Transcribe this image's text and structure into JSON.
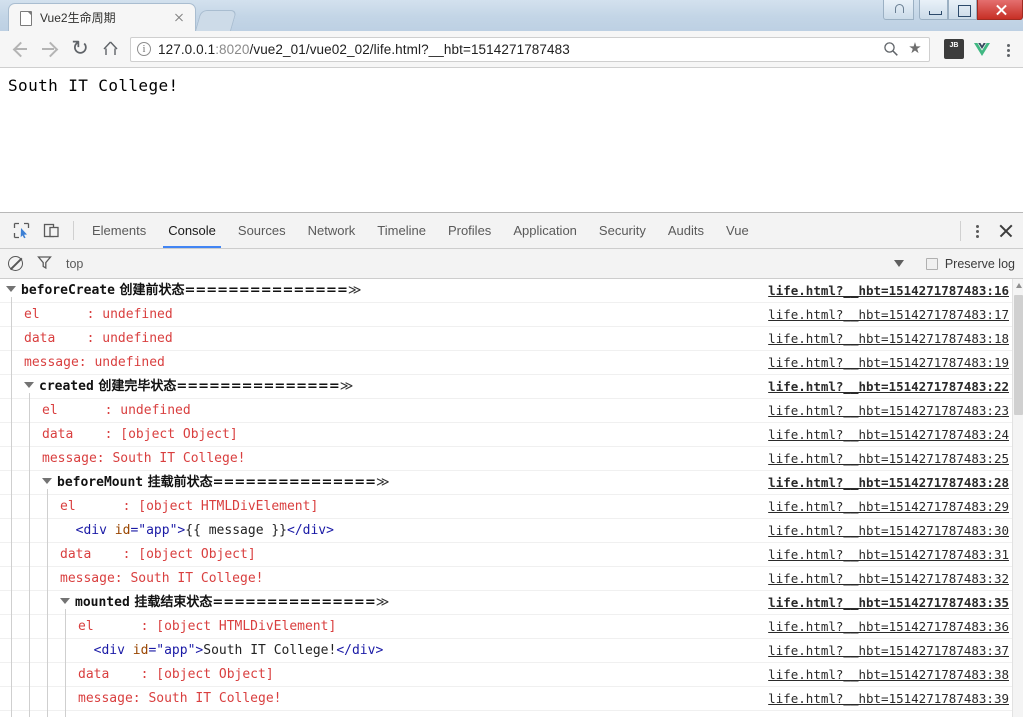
{
  "browser": {
    "tab": {
      "title": "Vue2生命周期",
      "favicon": "page-icon",
      "close": "×"
    },
    "window_controls": {
      "user": "user-icon",
      "minimize": "minimize-icon",
      "maximize": "maximize-icon",
      "close": "close-icon"
    },
    "toolbar": {
      "back": "back-arrow-icon",
      "forward": "forward-arrow-icon",
      "reload": "↻",
      "home": "home-icon",
      "info": "ⓘ",
      "url_host": "127.0.0.1",
      "url_port": ":8020",
      "url_path": "/vue2_01/vue02_02/life.html?__hbt=1514271787483",
      "url_full": "127.0.0.1:8020/vue2_01/vue02_02/life.html?__hbt=1514271787483",
      "zoom": "zoom-icon",
      "bookmark": "★",
      "ext_jetbrains": "JB",
      "ext_vue": "V",
      "menu": "chrome-menu-icon"
    }
  },
  "page": {
    "body_text": "South IT College!"
  },
  "devtools": {
    "tabs": [
      {
        "label": "Elements",
        "active": false
      },
      {
        "label": "Console",
        "active": true
      },
      {
        "label": "Sources",
        "active": false
      },
      {
        "label": "Network",
        "active": false
      },
      {
        "label": "Timeline",
        "active": false
      },
      {
        "label": "Profiles",
        "active": false
      },
      {
        "label": "Application",
        "active": false
      },
      {
        "label": "Security",
        "active": false
      },
      {
        "label": "Audits",
        "active": false
      },
      {
        "label": "Vue",
        "active": false
      }
    ],
    "inspect_icon": "inspect-element-icon",
    "device_icon": "device-toolbar-icon",
    "more_icon": "more-options-icon",
    "close_icon": "close-devtools-icon",
    "filterbar": {
      "clear_icon": "clear-console-icon",
      "filter_icon": "filter-icon",
      "context": "top",
      "context_caret": "▼",
      "preserve_log": "Preserve log",
      "preserve_checked": false
    },
    "console_rows": [
      {
        "type": "group",
        "depth": 0,
        "name": "beforeCreate",
        "cn": " 创建前状态===============",
        "link": "life.html?__hbt=1514271787483:16"
      },
      {
        "type": "prop",
        "depth": 1,
        "text": "el      : undefined",
        "link": "life.html?__hbt=1514271787483:17"
      },
      {
        "type": "prop",
        "depth": 1,
        "text": "data    : undefined",
        "link": "life.html?__hbt=1514271787483:18"
      },
      {
        "type": "prop",
        "depth": 1,
        "text": "message: undefined",
        "link": "life.html?__hbt=1514271787483:19"
      },
      {
        "type": "group",
        "depth": 1,
        "name": "created",
        "cn": " 创建完毕状态===============",
        "link": "life.html?__hbt=1514271787483:22"
      },
      {
        "type": "prop",
        "depth": 2,
        "text": "el      : undefined",
        "link": "life.html?__hbt=1514271787483:23"
      },
      {
        "type": "prop",
        "depth": 2,
        "text": "data    : [object Object]",
        "link": "life.html?__hbt=1514271787483:24"
      },
      {
        "type": "prop",
        "depth": 2,
        "text": "message: South IT College!",
        "link": "life.html?__hbt=1514271787483:25"
      },
      {
        "type": "group",
        "depth": 2,
        "name": "beforeMount",
        "cn": " 挂载前状态===============",
        "link": "life.html?__hbt=1514271787483:28"
      },
      {
        "type": "prop",
        "depth": 3,
        "text": "el      : [object HTMLDivElement]",
        "link": "life.html?__hbt=1514271787483:29"
      },
      {
        "type": "dom",
        "depth": 3,
        "tag_open": "<div ",
        "attr": "id",
        "eq": "=",
        "value": "\"app\"",
        "gt": ">",
        "inner": "{{ message }}",
        "tag_close": "</div>",
        "link": "life.html?__hbt=1514271787483:30"
      },
      {
        "type": "prop",
        "depth": 3,
        "text": "data    : [object Object]",
        "link": "life.html?__hbt=1514271787483:31"
      },
      {
        "type": "prop",
        "depth": 3,
        "text": "message: South IT College!",
        "link": "life.html?__hbt=1514271787483:32"
      },
      {
        "type": "group",
        "depth": 3,
        "name": "mounted",
        "cn": " 挂载结束状态===============",
        "link": "life.html?__hbt=1514271787483:35"
      },
      {
        "type": "prop",
        "depth": 4,
        "text": "el      : [object HTMLDivElement]",
        "link": "life.html?__hbt=1514271787483:36"
      },
      {
        "type": "dom",
        "depth": 4,
        "tag_open": "<div ",
        "attr": "id",
        "eq": "=",
        "value": "\"app\"",
        "gt": ">",
        "inner": "South IT College!",
        "tag_close": "</div>",
        "link": "life.html?__hbt=1514271787483:37"
      },
      {
        "type": "prop",
        "depth": 4,
        "text": "data    : [object Object]",
        "link": "life.html?__hbt=1514271787483:38"
      },
      {
        "type": "prop",
        "depth": 4,
        "text": "message: South IT College!",
        "link": "life.html?__hbt=1514271787483:39"
      }
    ],
    "group_chevron": "≫"
  },
  "colors": {
    "accent": "#4285f4",
    "log_property": "#d93f3f",
    "tab_close_red": "#c72f25",
    "dom_tag": "#1a1aa6",
    "dom_attr": "#994500"
  }
}
